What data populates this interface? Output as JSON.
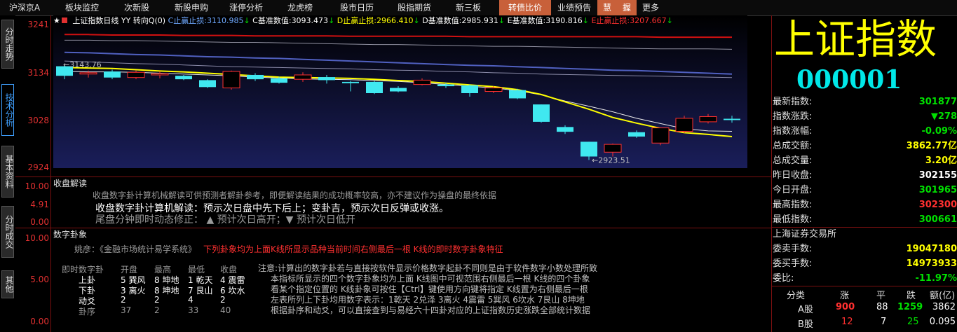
{
  "nav": [
    {
      "label": "沪深京A"
    },
    {
      "label": "板块监控"
    },
    {
      "label": "次新股"
    },
    {
      "label": "新股申购"
    },
    {
      "label": "涨停分析"
    },
    {
      "label": "龙虎榜"
    },
    {
      "label": "股市日历"
    },
    {
      "label": "股指期货"
    },
    {
      "label": "新三板"
    },
    {
      "label": "转债比价"
    },
    {
      "label": "业绩预告"
    },
    {
      "label": "慧"
    },
    {
      "label": "握"
    },
    {
      "label": "更多"
    }
  ],
  "side_tabs": [
    {
      "label": "分时走势"
    },
    {
      "label": "技术分析"
    },
    {
      "label": "基本资料"
    },
    {
      "label": "分时成交"
    },
    {
      "label": "其他"
    }
  ],
  "chart_info": {
    "title": "上证指数日线",
    "yy": "YY 转向Q(0)",
    "c_label": "C止赢止损:",
    "c_value": "3110.985",
    "cb_label": "C基准数值:",
    "cb_value": "3093.473",
    "d_label": "D止赢止损:",
    "d_value": "2966.410",
    "db_label": "D基准数值:",
    "db_value": "2985.931",
    "eb_label": "E基准数值:",
    "eb_value": "3190.816",
    "e_label": "E止赢止损:",
    "e_value": "3207.667",
    "down_arrow": "↓"
  },
  "chart_data": {
    "type": "candlestick",
    "y_ticks": [
      "3241",
      "3134",
      "3028",
      "2924"
    ],
    "ylim": [
      2915,
      3241
    ],
    "high_label": "3143.76",
    "low_label": "2923.51",
    "candles": [
      {
        "o": 3140,
        "c": 3118,
        "h": 3144,
        "l": 3110
      },
      {
        "o": 3122,
        "c": 3125,
        "h": 3130,
        "l": 3114
      },
      {
        "o": 3128,
        "c": 3114,
        "h": 3132,
        "l": 3110
      },
      {
        "o": 3114,
        "c": 3126,
        "h": 3130,
        "l": 3110
      },
      {
        "o": 3120,
        "c": 3123,
        "h": 3128,
        "l": 3112
      },
      {
        "o": 3118,
        "c": 3110,
        "h": 3120,
        "l": 3108
      },
      {
        "o": 3108,
        "c": 3092,
        "h": 3110,
        "l": 3090
      },
      {
        "o": 3090,
        "c": 3128,
        "h": 3130,
        "l": 3086
      },
      {
        "o": 3120,
        "c": 3110,
        "h": 3124,
        "l": 3106
      },
      {
        "o": 3112,
        "c": 3102,
        "h": 3116,
        "l": 3100
      },
      {
        "o": 3110,
        "c": 3120,
        "h": 3126,
        "l": 3104
      },
      {
        "o": 3115,
        "c": 3108,
        "h": 3120,
        "l": 3100
      },
      {
        "o": 3104,
        "c": 3101,
        "h": 3106,
        "l": 3082
      },
      {
        "o": 3104,
        "c": 3078,
        "h": 3106,
        "l": 3076
      },
      {
        "o": 3090,
        "c": 3082,
        "h": 3094,
        "l": 3080
      },
      {
        "o": 3098,
        "c": 3108,
        "h": 3112,
        "l": 3096
      },
      {
        "o": 3098,
        "c": 3094,
        "h": 3102,
        "l": 3090
      },
      {
        "o": 3096,
        "c": 3078,
        "h": 3098,
        "l": 3070
      },
      {
        "o": 3082,
        "c": 3090,
        "h": 3094,
        "l": 3078
      },
      {
        "o": 3085,
        "c": 3066,
        "h": 3088,
        "l": 3064
      },
      {
        "o": 3052,
        "c": 3012,
        "h": 3052,
        "l": 3010
      },
      {
        "o": 3000,
        "c": 2989,
        "h": 3004,
        "l": 2984
      },
      {
        "o": 2966,
        "c": 2932,
        "h": 2966,
        "l": 2924
      },
      {
        "o": 2942,
        "c": 2960,
        "h": 2962,
        "l": 2932
      },
      {
        "o": 2988,
        "c": 2978,
        "h": 2992,
        "l": 2975
      },
      {
        "o": 2963,
        "c": 2998,
        "h": 2998,
        "l": 2958
      },
      {
        "o": 2990,
        "c": 3020,
        "h": 3026,
        "l": 2986
      },
      {
        "o": 3012,
        "c": 3024,
        "h": 3030,
        "l": 3008
      },
      {
        "o": 3019,
        "c": 3016,
        "h": 3026,
        "l": 3010
      }
    ],
    "ma_yellow": [
      3137,
      3136,
      3135,
      3132,
      3129,
      3127,
      3124,
      3121,
      3118,
      3115,
      3114,
      3113,
      3112,
      3110,
      3107,
      3105,
      3101,
      3097,
      3093,
      3086,
      3075,
      3058,
      3041,
      3022,
      3009,
      2997,
      2987,
      2983,
      2978
    ],
    "ma_white": [
      3128,
      3127,
      3127,
      3126,
      3124,
      3122,
      3120,
      3118,
      3115,
      3113,
      3111,
      3110,
      3109,
      3107,
      3105,
      3102,
      3098,
      3094,
      3090,
      3084,
      3074,
      3060,
      3048,
      3035,
      3020,
      3008,
      2996,
      2991,
      2990
    ],
    "ma_slate": [
      3152,
      3150,
      3148,
      3146,
      3145,
      3143,
      3141,
      3139,
      3138,
      3137,
      3136,
      3135,
      3134,
      3132,
      3131,
      3130,
      3128,
      3127,
      3125,
      3124,
      3122,
      3121,
      3120,
      3119,
      3118,
      3117,
      3116,
      3115,
      3114
    ],
    "ma_blue": [
      3172,
      3171,
      3169,
      3167,
      3166,
      3164,
      3162,
      3161,
      3159,
      3158,
      3156,
      3154,
      3152,
      3150,
      3148,
      3146,
      3144,
      3142,
      3141,
      3139,
      3137,
      3135,
      3133,
      3131,
      3130,
      3128,
      3126,
      3124,
      3122
    ],
    "ma_gray": [
      3200,
      3200,
      3199,
      3199,
      3198,
      3197,
      3196,
      3195,
      3195,
      3194,
      3193,
      3192,
      3191,
      3190,
      3190,
      3189,
      3188,
      3187,
      3186,
      3186,
      3185,
      3184,
      3183,
      3182,
      3181,
      3180,
      3180,
      3180,
      3179
    ],
    "ma_red": [
      3213,
      3213,
      3212,
      3212,
      3212,
      3211,
      3211,
      3211,
      3210,
      3210,
      3210,
      3210,
      3209,
      3209,
      3209,
      3209,
      3209,
      3208,
      3208,
      3208,
      3208,
      3208,
      3208,
      3208,
      3208,
      3207,
      3207,
      3207,
      3207
    ]
  },
  "panel1": {
    "title": "收盘解读",
    "y_labels": [
      "10.00",
      "4.91",
      "0.00"
    ],
    "line1": "收盘数字卦计算机械解读可供预测者解卦参考，即便解读结果的成功概率较高，亦不建议作为操盘的最终依据",
    "line2": "收盘数字卦计算机解读：预示次日盘中先下后上；变卦吉，预示次日反弹或收涨。",
    "line3": "尾盘分钟即时动态修正：  ▲ 预计次日高开；▼ 预计次日低开"
  },
  "panel2": {
    "title": "数字卦象",
    "y_labels": [
      "10.00",
      "5.00",
      "0.00"
    ],
    "author": "姚彦：《金融市场统计易学系统》",
    "warning": "下列卦象均为上面K线所显示品种当前时间右侧最后一根 K线的即时数字卦象特征",
    "table_headers": [
      "即时数字卦",
      "开盘",
      "最高",
      "最低",
      "收盘"
    ],
    "rows": [
      {
        "name": "上卦",
        "open": "5 巽风",
        "high": "8 坤地",
        "low": "1 乾天",
        "close": "4 震雷"
      },
      {
        "name": "下卦",
        "open": "3 离火",
        "high": "8 坤地",
        "low": "7 艮山",
        "close": "6 坎水"
      },
      {
        "name": "动爻",
        "open": "2",
        "high": "2",
        "low": "4",
        "close": "2"
      },
      {
        "name": "卦序",
        "open": "37",
        "high": "2",
        "low": "33",
        "close": "40"
      }
    ],
    "notes": [
      "注意:计算出的数字卦若与直接按软件显示价格数字起卦不同则是由于软件数字小数处理所致",
      "本指标所显示的四个数字卦象均为上面 K线图中可视范围右侧最后一根 K线的四个卦象",
      "看某个指定位置的 K线卦象可按住【Ctrl】键使用方向键将指定 K线置为右侧最后一根",
      "左表所列上下卦均用数字表示：1乾天 2兑泽 3离火 4震雷 5巽风 6坎水 7艮山 8坤地",
      "根据卦序和动爻，可以直接查到与易经六十四卦对应的上证指数历史涨跌全部统计数据"
    ]
  },
  "right": {
    "big_title": "上证指数",
    "code": "000001",
    "rows": [
      {
        "k": "最新指数:",
        "v": "301877",
        "c": "green"
      },
      {
        "k": "指数涨跌:",
        "v": "▼278",
        "c": "green"
      },
      {
        "k": "指数涨幅:",
        "v": "-0.09%",
        "c": "green"
      },
      {
        "k": "总成交额:",
        "v": "3862.77亿",
        "c": "yellow"
      },
      {
        "k": "总成交量:",
        "v": "3.20亿",
        "c": "yellow"
      },
      {
        "k": "昨日收盘:",
        "v": "302155",
        "c": "white"
      },
      {
        "k": "今日开盘:",
        "v": "301965",
        "c": "green"
      },
      {
        "k": "最高指数:",
        "v": "302300",
        "c": "red"
      },
      {
        "k": "最低指数:",
        "v": "300661",
        "c": "green"
      }
    ],
    "exchange": "上海证券交易所",
    "rows2": [
      {
        "k": "委卖手数:",
        "v": "19047180",
        "c": "yellow"
      },
      {
        "k": "委买手数:",
        "v": "14973933",
        "c": "yellow"
      },
      {
        "k": "委比:",
        "v": "-11.97%",
        "c": "green"
      }
    ],
    "table_headers": [
      "分类",
      "涨",
      "平",
      "跌",
      "额(亿)"
    ],
    "table_rows": [
      {
        "name": "A股",
        "up": "900",
        "flat": "88",
        "down": "1259",
        "amt": "3862"
      },
      {
        "name": "B股",
        "up": "12",
        "flat": "7",
        "down": "25",
        "amt": "0.095"
      }
    ]
  }
}
